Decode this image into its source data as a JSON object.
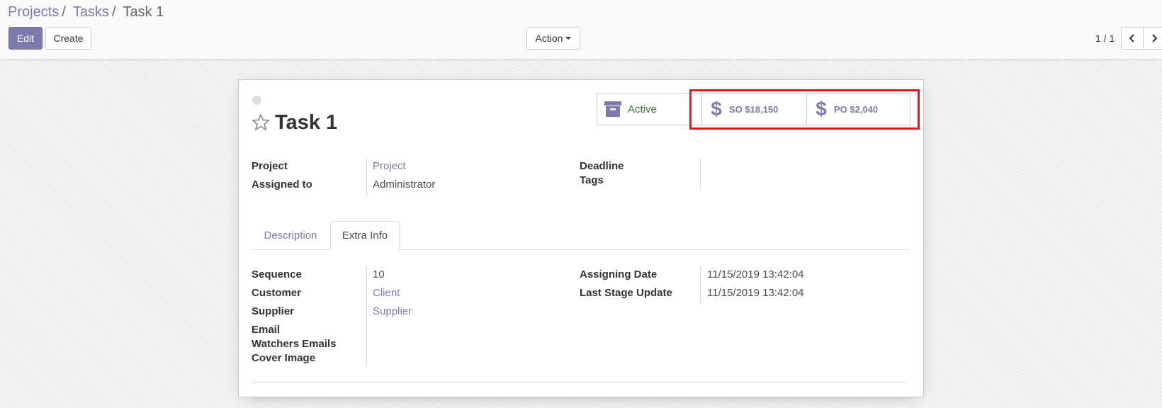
{
  "breadcrumb": [
    "Projects",
    "Tasks",
    "Task 1"
  ],
  "breadcrumb_separator": "/",
  "buttons": {
    "edit": "Edit",
    "create": "Create",
    "action": "Action"
  },
  "pager": {
    "value": "1 / 1"
  },
  "record": {
    "title": "Task 1",
    "smart_buttons": {
      "active": "Active",
      "so": "SO $18,150",
      "po": "PO $2,040"
    },
    "fields_top": {
      "project_label": "Project",
      "project_value": "Project",
      "assigned_label": "Assigned to",
      "assigned_value": "Administrator",
      "deadline_label": "Deadline",
      "tags_label": "Tags"
    },
    "tabs": [
      "Description",
      "Extra Info"
    ],
    "extra_info": {
      "sequence_label": "Sequence",
      "sequence_value": "10",
      "customer_label": "Customer",
      "customer_value": "Client",
      "supplier_label": "Supplier",
      "supplier_value": "Supplier",
      "email_label": "Email",
      "watchers_label": "Watchers Emails",
      "cover_label": "Cover Image",
      "assigning_date_label": "Assigning Date",
      "assigning_date_value": "11/15/2019 13:42:04",
      "last_stage_label": "Last Stage Update",
      "last_stage_value": "11/15/2019 13:42:04"
    }
  },
  "colors": {
    "brand": "#7c7bad",
    "active_text": "#2f7a2f",
    "highlight": "#e01818"
  },
  "icons": {
    "archive": "archive-icon",
    "dollar": "dollar-icon",
    "star": "star-outline-icon",
    "prev": "chevron-left-icon",
    "next": "chevron-right-icon"
  }
}
